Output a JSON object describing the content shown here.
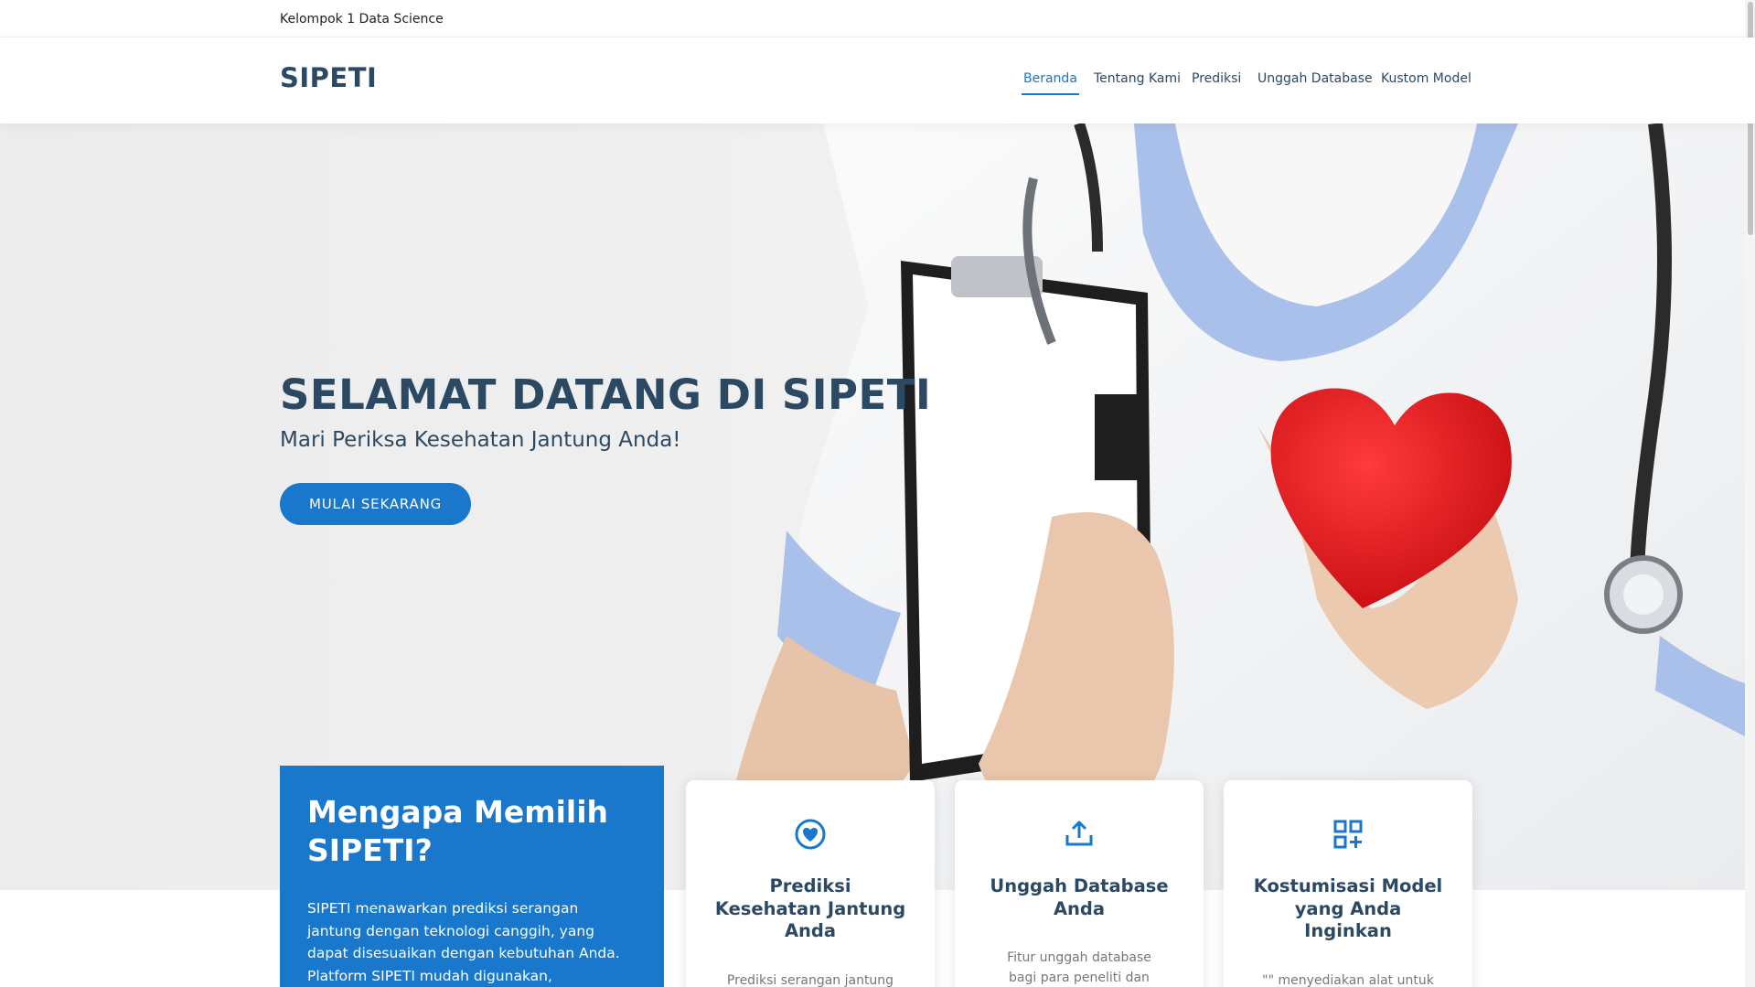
{
  "topbar": {
    "text": "Kelompok 1 Data Science"
  },
  "header": {
    "logo": "SIPETI",
    "nav": [
      {
        "label": "Beranda",
        "active": true
      },
      {
        "label": "Tentang Kami",
        "active": false
      },
      {
        "label": "Prediksi",
        "active": false
      },
      {
        "label": "Unggah Database",
        "active": false
      },
      {
        "label": "Kustom Model",
        "active": false
      }
    ]
  },
  "hero": {
    "title": "SELAMAT DATANG DI SIPETI",
    "subtitle": "Mari Periksa Kesehatan Jantung Anda!",
    "button_label": "MULAI SEKARANG"
  },
  "why": {
    "title": "Mengapa Memilih SIPETI?",
    "text": "SIPETI menawarkan prediksi serangan jantung dengan teknologi canggih, yang dapat disesuaikan dengan kebutuhan Anda. Platform SIPETI mudah digunakan, memungkinkan unggah"
  },
  "cards": [
    {
      "icon": "heart-circle-icon",
      "title": "Prediksi Kesehatan Jantung Anda",
      "text": "Prediksi serangan jantung Anda secara dini."
    },
    {
      "icon": "upload-icon",
      "title": "Unggah Database Anda",
      "text": "Fitur unggah database bagi para peneliti dan profesional"
    },
    {
      "icon": "grid-add-icon",
      "title": "Kostumisasi Model yang Anda Inginkan",
      "text": "\"\" menyediakan alat untuk kostumisasi model prediksi"
    }
  ],
  "colors": {
    "accent": "#1977cc",
    "heading": "#2c4964",
    "muted": "#777777"
  }
}
